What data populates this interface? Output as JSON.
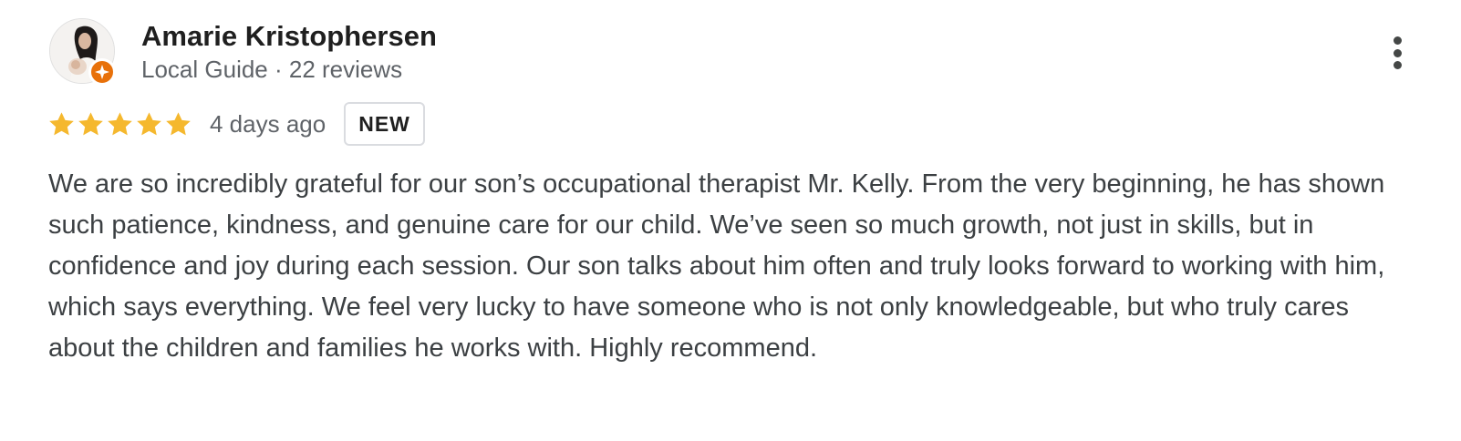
{
  "review": {
    "author": {
      "name": "Amarie Kristophersen",
      "meta": "Local Guide · 22 reviews",
      "avatar_icon": "profile-photo",
      "badge_icon": "local-guide-star-icon",
      "badge_color": "#e8710a"
    },
    "rating": {
      "stars": 5,
      "max": 5,
      "star_color": "#f5b82e"
    },
    "date": "4 days ago",
    "badge": "NEW",
    "text": "We are so incredibly grateful for our son’s occupational therapist Mr. Kelly. From the very beginning, he has shown such patience, kindness, and genuine care for our child. We’ve seen so much growth, not just in skills, but in confidence and joy during each session. Our son talks about him often and truly looks forward to working with him, which says everything. We feel very lucky to have someone who is not only knowledgeable, but who truly cares about the children and families he works with. Highly recommend.",
    "more_icon": "more-vert-icon"
  }
}
